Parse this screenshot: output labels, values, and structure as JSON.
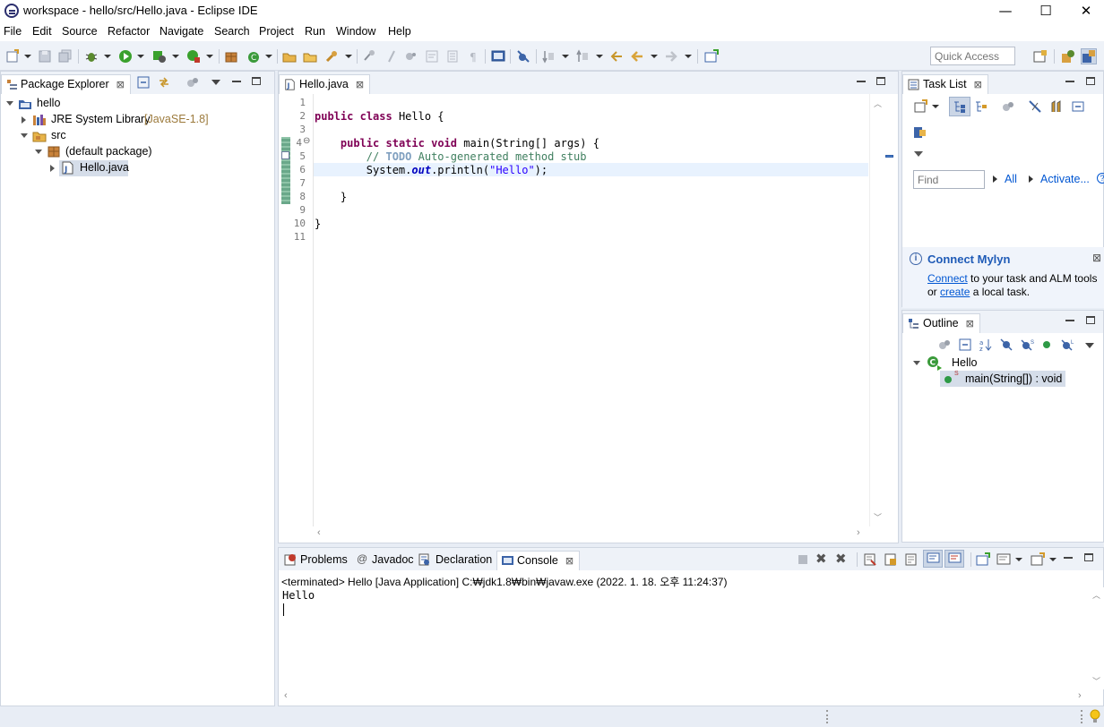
{
  "window": {
    "title": "workspace - hello/src/Hello.java - Eclipse IDE",
    "minimize": "—",
    "maximize": "☐",
    "close": "✕"
  },
  "menu": [
    "File",
    "Edit",
    "Source",
    "Refactor",
    "Navigate",
    "Search",
    "Project",
    "Run",
    "Window",
    "Help"
  ],
  "toolbar": {
    "quick_access_placeholder": "Quick Access"
  },
  "package_explorer": {
    "tab_label": "Package Explorer",
    "tree": [
      {
        "label": "hello",
        "depth": 0,
        "state": "expanded",
        "icon": "project-icon"
      },
      {
        "label": "JRE System Library",
        "suffix": "[JavaSE-1.8]",
        "depth": 1,
        "state": "collapsed",
        "icon": "library-icon"
      },
      {
        "label": "src",
        "depth": 1,
        "state": "expanded",
        "icon": "source-folder-icon"
      },
      {
        "label": "(default package)",
        "depth": 2,
        "state": "expanded",
        "icon": "package-icon"
      },
      {
        "label": "Hello.java",
        "depth": 3,
        "state": "collapsed",
        "icon": "java-file-icon",
        "selected": true
      }
    ]
  },
  "editor": {
    "tab_label": "Hello.java",
    "line_numbers": [
      "1",
      "2",
      "3",
      "4",
      "5",
      "6",
      "7",
      "8",
      "9",
      "10",
      "11"
    ],
    "fold_marker": "⊖",
    "code": {
      "l2_kw1": "public",
      "l2_kw2": "class",
      "l2_rest": " Hello {",
      "l4_kw1": "public",
      "l4_kw2": "static",
      "l4_kw3": "void",
      "l4_rest": " main(String[] args) {",
      "l5_comment": "// ",
      "l5_todo": "TODO",
      "l5_rest": " Auto-generated method stub",
      "l6_a": "System.",
      "l6_field": "out",
      "l6_b": ".println(",
      "l6_str": "\"Hello\"",
      "l6_c": ");",
      "l8": "}",
      "l10": "}"
    }
  },
  "task_list": {
    "tab_label": "Task List",
    "find_placeholder": "Find",
    "all_label": "All",
    "activate_label": "Activate...",
    "mylyn_title": "Connect Mylyn",
    "mylyn_connect": "Connect",
    "mylyn_text1": " to your task and ALM tools",
    "mylyn_or": "or ",
    "mylyn_create": "create",
    "mylyn_text2": " a local task."
  },
  "outline": {
    "tab_label": "Outline",
    "class_name": "Hello",
    "method": "main(String[]) : void"
  },
  "console": {
    "tabs": [
      "Problems",
      "Javadoc",
      "Declaration",
      "Console"
    ],
    "header": "<terminated> Hello [Java Application] C:₩jdk1.8₩bin₩javaw.exe (2022. 1. 18. 오후 11:24:37)",
    "output": "Hello"
  },
  "colors": {
    "keyword": "#7f0055",
    "comment": "#3f7f5f",
    "string": "#2a00ff",
    "link": "#0056d2"
  }
}
